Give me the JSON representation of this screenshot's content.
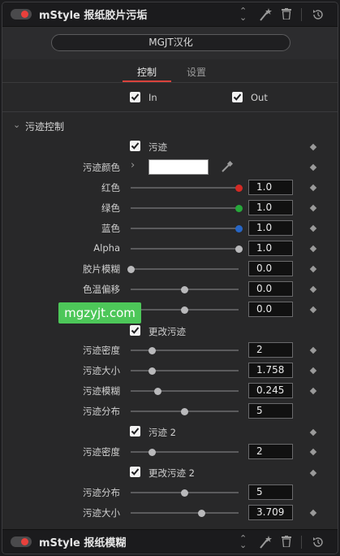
{
  "top_header": {
    "title": "mStyle 报纸胶片污垢"
  },
  "bottom_header": {
    "title": "mStyle 报纸模糊"
  },
  "preset": {
    "label": "MGJT汉化"
  },
  "tabs": [
    {
      "label": "控制"
    },
    {
      "label": "设置"
    }
  ],
  "io": {
    "in_label": "In",
    "out_label": "Out"
  },
  "section": {
    "title": "污迹控制"
  },
  "rows": {
    "stain_toggle": "污迹",
    "stain_color": "污迹颜色",
    "red": {
      "label": "红色",
      "value": "1.0",
      "fraction": 1.0
    },
    "green": {
      "label": "绿色",
      "value": "1.0",
      "fraction": 1.0
    },
    "blue": {
      "label": "蓝色",
      "value": "1.0",
      "fraction": 1.0
    },
    "alpha": {
      "label": "Alpha",
      "value": "1.0",
      "fraction": 1.0
    },
    "film_blur": {
      "label": "胶片模糊",
      "value": "0.0",
      "fraction": 0.0
    },
    "color_temp": {
      "label": "色温偏移",
      "value": "0.0",
      "fraction": 0.5
    },
    "hidden_row": {
      "value": "0.0",
      "fraction": 0.5
    },
    "change_stain": "更改污迹",
    "stain_density": {
      "label": "污迹密度",
      "value": "2",
      "fraction": 0.2
    },
    "stain_size": {
      "label": "污迹大小",
      "value": "1.758",
      "fraction": 0.2
    },
    "stain_blur": {
      "label": "污迹模糊",
      "value": "0.245",
      "fraction": 0.25
    },
    "stain_dist": {
      "label": "污迹分布",
      "value": "5",
      "fraction": 0.5
    },
    "stain2_toggle": "污迹 2",
    "stain2_density": {
      "label": "污迹密度",
      "value": "2",
      "fraction": 0.2
    },
    "change_stain2": "更改污迹 2",
    "stain2_dist": {
      "label": "污迹分布",
      "value": "5",
      "fraction": 0.5
    },
    "stain2_size": {
      "label": "污迹大小",
      "value": "3.709",
      "fraction": 0.66
    }
  },
  "watermark": {
    "text": "mgzyjt.com"
  },
  "colors": {
    "accent": "#d9433c",
    "knob_red": "#d42a24",
    "knob_green": "#26a83a",
    "knob_blue": "#2766c6",
    "watermark_bg": "#4dc759"
  }
}
